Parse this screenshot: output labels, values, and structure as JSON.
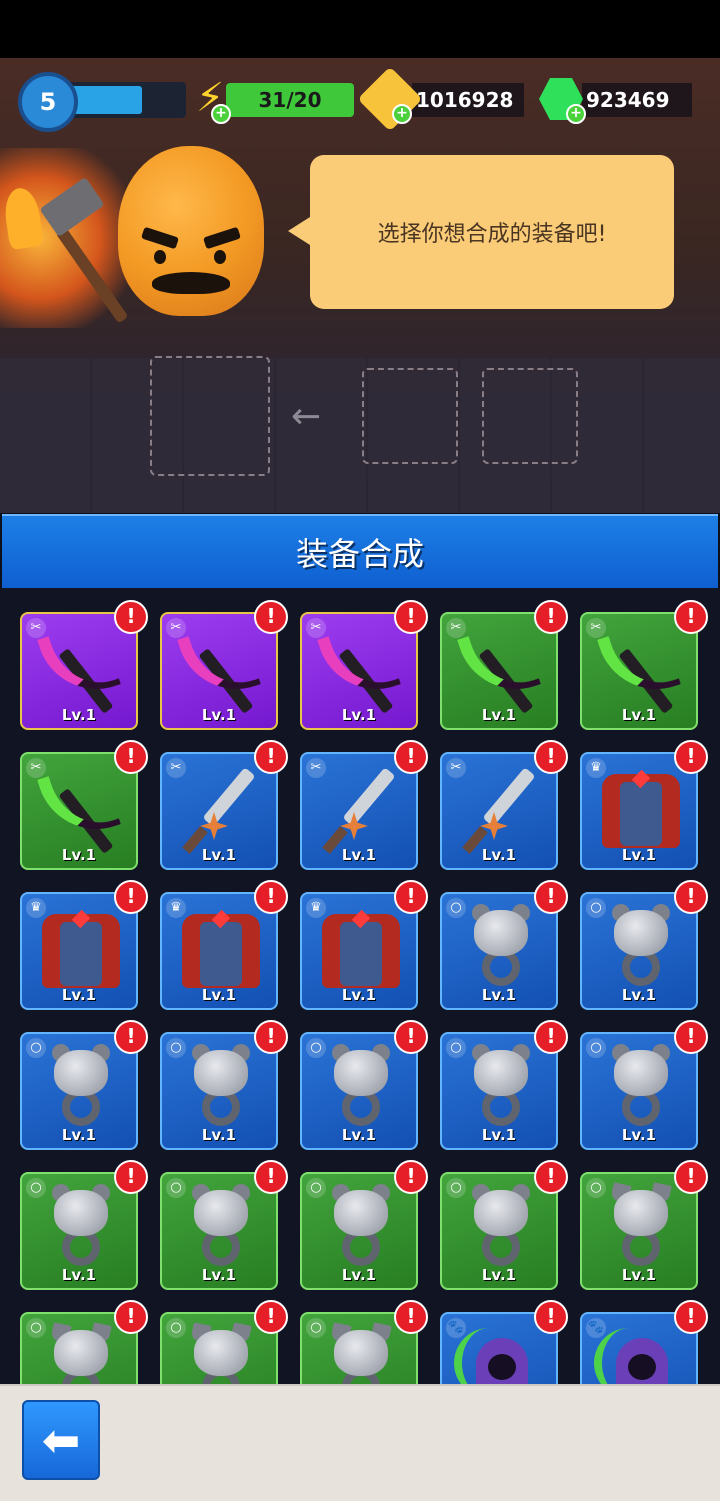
{
  "hud": {
    "player_level": "5",
    "xp_progress": 0.82,
    "energy": "31/20",
    "gold": "1016928",
    "gems": "923469"
  },
  "dialog": {
    "message": "选择你想合成的装备吧!"
  },
  "panel": {
    "title": "装备合成"
  },
  "icons": {
    "back": "arrow-left-icon",
    "alert": "exclamation-icon",
    "energy": "lightning-icon",
    "gold": "gold-coin-icon",
    "gems": "green-gem-icon"
  },
  "colors": {
    "epic": "#8a2be2",
    "uncommon": "#2f8f2a",
    "rare": "#1d63c8",
    "alert": "#e51e28",
    "header": "#1a78e0"
  },
  "alert_mark": "!",
  "equipment": [
    {
      "kind": "scythe",
      "rarity": "purple",
      "type_icon": "✂",
      "level": "Lv.1"
    },
    {
      "kind": "scythe",
      "rarity": "purple",
      "type_icon": "✂",
      "level": "Lv.1"
    },
    {
      "kind": "scythe",
      "rarity": "purple",
      "type_icon": "✂",
      "level": "Lv.1"
    },
    {
      "kind": "scythe",
      "rarity": "green",
      "type_icon": "✂",
      "level": "Lv.1"
    },
    {
      "kind": "scythe",
      "rarity": "green",
      "type_icon": "✂",
      "level": "Lv.1"
    },
    {
      "kind": "scythe",
      "rarity": "green",
      "type_icon": "✂",
      "level": "Lv.1"
    },
    {
      "kind": "sword",
      "rarity": "blue",
      "type_icon": "✂",
      "level": "Lv.1"
    },
    {
      "kind": "sword",
      "rarity": "blue",
      "type_icon": "✂",
      "level": "Lv.1"
    },
    {
      "kind": "sword",
      "rarity": "blue",
      "type_icon": "✂",
      "level": "Lv.1"
    },
    {
      "kind": "armor",
      "rarity": "blue",
      "type_icon": "♛",
      "level": "Lv.1"
    },
    {
      "kind": "armor",
      "rarity": "blue",
      "type_icon": "♛",
      "level": "Lv.1"
    },
    {
      "kind": "armor",
      "rarity": "blue",
      "type_icon": "♛",
      "level": "Lv.1"
    },
    {
      "kind": "armor",
      "rarity": "blue",
      "type_icon": "♛",
      "level": "Lv.1"
    },
    {
      "kind": "ring",
      "rarity": "blue",
      "type_icon": "○",
      "level": "Lv.1"
    },
    {
      "kind": "ring",
      "rarity": "blue",
      "type_icon": "○",
      "level": "Lv.1"
    },
    {
      "kind": "ring",
      "rarity": "blue",
      "type_icon": "○",
      "level": "Lv.1"
    },
    {
      "kind": "ring",
      "rarity": "blue",
      "type_icon": "○",
      "level": "Lv.1"
    },
    {
      "kind": "ring",
      "rarity": "blue",
      "type_icon": "○",
      "level": "Lv.1"
    },
    {
      "kind": "ring",
      "rarity": "blue",
      "type_icon": "○",
      "level": "Lv.1"
    },
    {
      "kind": "ring",
      "rarity": "blue",
      "type_icon": "○",
      "level": "Lv.1"
    },
    {
      "kind": "ring",
      "rarity": "green",
      "type_icon": "○",
      "level": "Lv.1"
    },
    {
      "kind": "ring",
      "rarity": "green",
      "type_icon": "○",
      "level": "Lv.1"
    },
    {
      "kind": "ring",
      "rarity": "green",
      "type_icon": "○",
      "level": "Lv.1"
    },
    {
      "kind": "ring",
      "rarity": "green",
      "type_icon": "○",
      "level": "Lv.1"
    },
    {
      "kind": "wolf-ring",
      "rarity": "green",
      "type_icon": "○",
      "level": "Lv.1"
    },
    {
      "kind": "wolf-ring",
      "rarity": "green",
      "type_icon": "○",
      "level": ""
    },
    {
      "kind": "wolf-ring",
      "rarity": "green",
      "type_icon": "○",
      "level": ""
    },
    {
      "kind": "wolf-ring",
      "rarity": "green",
      "type_icon": "○",
      "level": ""
    },
    {
      "kind": "reaper",
      "rarity": "blue",
      "type_icon": "🐾",
      "level": ""
    },
    {
      "kind": "reaper",
      "rarity": "blue",
      "type_icon": "🐾",
      "level": ""
    }
  ]
}
